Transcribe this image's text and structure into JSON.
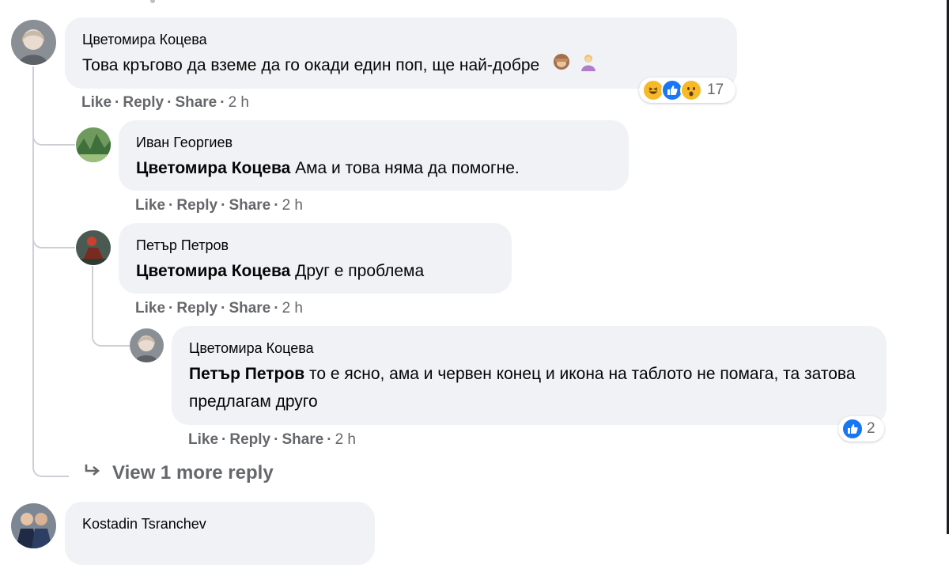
{
  "comments": [
    {
      "author": "Цветомира Коцева",
      "text": "Това кръгово да вземе да го окади един поп, ще най-добре",
      "emojis": [
        "see-no-evil-monkey",
        "woman-shrugging"
      ],
      "reactions": {
        "types": [
          "haha",
          "like",
          "wow"
        ],
        "count": "17"
      },
      "actions": {
        "like": "Like",
        "reply": "Reply",
        "share": "Share",
        "time": "2 h",
        "sep": "·"
      }
    },
    {
      "author": "Иван Георгиев",
      "mention": "Цветомира Коцева",
      "text": " Ама и това няма да помогне.",
      "actions": {
        "like": "Like",
        "reply": "Reply",
        "share": "Share",
        "time": "2 h",
        "sep": "·"
      }
    },
    {
      "author": "Петър Петров",
      "mention": "Цветомира Коцева",
      "text": " Друг е проблема",
      "actions": {
        "like": "Like",
        "reply": "Reply",
        "share": "Share",
        "time": "2 h",
        "sep": "·"
      }
    },
    {
      "author": "Цветомира Коцева",
      "mention": "Петър Петров",
      "text": " то е ясно, ама и червен конец и икона на таблото не помага, та затова предлагам друго",
      "reactions": {
        "types": [
          "like"
        ],
        "count": "2"
      },
      "actions": {
        "like": "Like",
        "reply": "Reply",
        "share": "Share",
        "time": "2 h",
        "sep": "·"
      }
    },
    {
      "author": "Kostadin Tsranchev"
    }
  ],
  "view_more": {
    "label": "View 1 more reply",
    "icon": "reply-arrow-icon"
  },
  "colors": {
    "bubble": "#f0f2f5",
    "meta": "#65676b",
    "like": "#1877f2",
    "haha": "#f7b928",
    "thread": "#ccd0d5"
  }
}
